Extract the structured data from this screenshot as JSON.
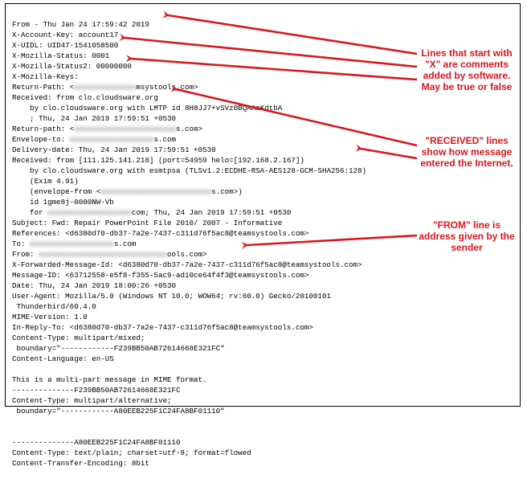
{
  "headers": {
    "l01a": "From - Thu Jan 24 17:59:42 2019",
    "l02": "X-Account-Key: account17",
    "l03": "X-UIDL: UID47-1541058500",
    "l04": "X-Mozilla-Status: 0001",
    "l05": "X-Mozilla-Status2: 00000000",
    "l06": "X-Mozilla-Keys:",
    "l07a": "Return-Path: <",
    "l07m": "aaaaaaaaaaaaaa",
    "l07b": "msystools.com>",
    "l08": "Received: from clo.cloudsware.org",
    "l09": "    by clo.cloudsware.org with LMTP id 8H8JJ7+vSVz0BQAAaKdtbA",
    "l10": "    ; Thu, 24 Jan 2019 17:59:51 +0530",
    "l11a": "Return-path: <",
    "l11m": "aaaaaaaaaaaaaaaaaaaaaaa",
    "l11b": "s.com>",
    "l12a": "Envelope-to: ",
    "l12m": "aaaaaaaaaaaaaaaaaaa",
    "l12b": "s.com",
    "l13": "Delivery-date: Thu, 24 Jan 2019 17:59:51 +0530",
    "l14": "Received: from [111.125.141.218] (port=54959 helo=[192.168.2.167])",
    "l15": "    by clo.cloudsware.org with esmtpsa (TLSv1.2:ECDHE-RSA-AES128-GCM-SHA256:128)",
    "l16": "    (Exim 4.91)",
    "l17a": "    (envelope-from <",
    "l17m": "aaaaaaaaaaaaaaaaaaaaaaaaa",
    "l17b": "s.com>)",
    "l18": "    id 1gme8j-0000NW-Vb",
    "l19a": "    for ",
    "l19m": "aaaaaaaaaaaaaaaaaaa",
    "l19b": "com; Thu, 24 Jan 2019 17:59:51 +0530",
    "l20": "Subject: Fwd: Repair PowerPoint File 2010/ 2007 - Informative",
    "l21": "References: <d6380d70-db37-7a2e-7437-c311d76f5ac8@teamsystools.com>",
    "l22a": "To: ",
    "l22m": "aaaaaaaaaaaaaaaaaaa",
    "l22b": "s.com",
    "l23a": "From: ",
    "l23m": "aaaaaaaaaaaaaaaaaaaaaaaaaaaaa",
    "l23b": "ools.com>",
    "l24": "X-Forwarded-Message-Id: <d6380d70-db37-7a2e-7437-c311d76f5ac8@teamsystools.com>",
    "l25": "Message-ID: <63712558-e5f8-f355-5ac9-ad10ce64f4f3@teamsystools.com>",
    "l26": "Date: Thu, 24 Jan 2019 18:00:26 +0530",
    "l27": "User-Agent: Mozilla/5.0 (Windows NT 10.0; WOW64; rv:60.0) Gecko/20100101",
    "l28": " Thunderbird/60.4.0",
    "l29": "MIME-Version: 1.0",
    "l30": "In-Reply-To: <d6380d70-db37-7a2e-7437-c311d76f5ac8@teamsystools.com>",
    "l31": "Content-Type: multipart/mixed;",
    "l32": " boundary=\"------------F239BB50AB72614668E321FC\"",
    "l33": "Content-Language: en-US",
    "blank1": "",
    "l34": "This is a multi-part message in MIME format.",
    "l35": "--------------F239BB50AB72614668E321FC",
    "l36": "Content-Type: multipart/alternative;",
    "l37": " boundary=\"------------A80EEB225F1C24FA8BF01110\"",
    "blank2": "",
    "blank3": "",
    "l38": "--------------A80EEB225F1C24FA8BF01110",
    "l39": "Content-Type: text/plain; charset=utf-8; format=flowed",
    "l40": "Content-Transfer-Encoding: 8bit"
  },
  "callouts": {
    "x_comments": "Lines that start with \"X\" are comments added by software. May be true or false",
    "received": "\"RECEIVED\" lines show how message entered the Internet.",
    "from": "\"FROM\" line is address given by the sender"
  },
  "colors": {
    "annotation": "#d8171e"
  }
}
